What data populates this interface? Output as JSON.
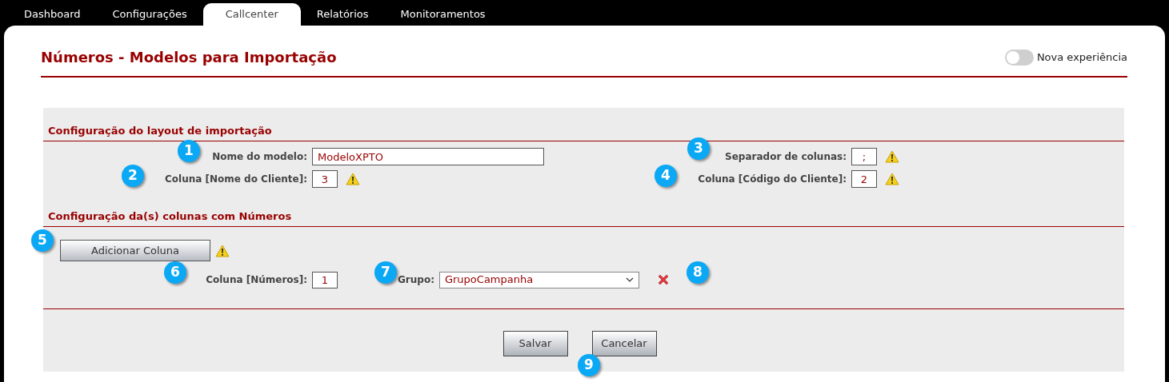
{
  "tabs": [
    {
      "label": "Dashboard",
      "selected": false
    },
    {
      "label": "Configurações",
      "selected": false
    },
    {
      "label": "Callcenter",
      "selected": true
    },
    {
      "label": "Relatórios",
      "selected": false
    },
    {
      "label": "Monitoramentos",
      "selected": false
    }
  ],
  "title": "Números - Modelos para Importação",
  "toggle": {
    "label": "Nova experiência",
    "on": false
  },
  "layout_section": {
    "heading": "Configuração do layout de importação",
    "left_fields": [
      {
        "label": "Nome do modelo:",
        "value": "ModeloXPTO",
        "kind": "wide",
        "warning": false
      },
      {
        "label": "Coluna [Nome do Cliente]:",
        "value": "3",
        "kind": "small",
        "warning": true
      }
    ],
    "right_fields": [
      {
        "label": "Separador de colunas:",
        "value": ";",
        "kind": "small",
        "warning": true
      },
      {
        "label": "Coluna [Código do Cliente]:",
        "value": "2",
        "kind": "small",
        "warning": true
      }
    ]
  },
  "numbers_section": {
    "heading": "Configuração da(s) colunas com Números",
    "add_button": {
      "label": "Adicionar Coluna",
      "warning": true
    },
    "rows": [
      {
        "column_label": "Coluna [Números]:",
        "column_value": "1",
        "group_label": "Grupo:",
        "group_value": "GrupoCampanha"
      }
    ]
  },
  "buttons": [
    "Salvar",
    "Cancelar"
  ],
  "markers": [
    "1",
    "2",
    "3",
    "4",
    "5",
    "6",
    "7",
    "8",
    "9"
  ]
}
